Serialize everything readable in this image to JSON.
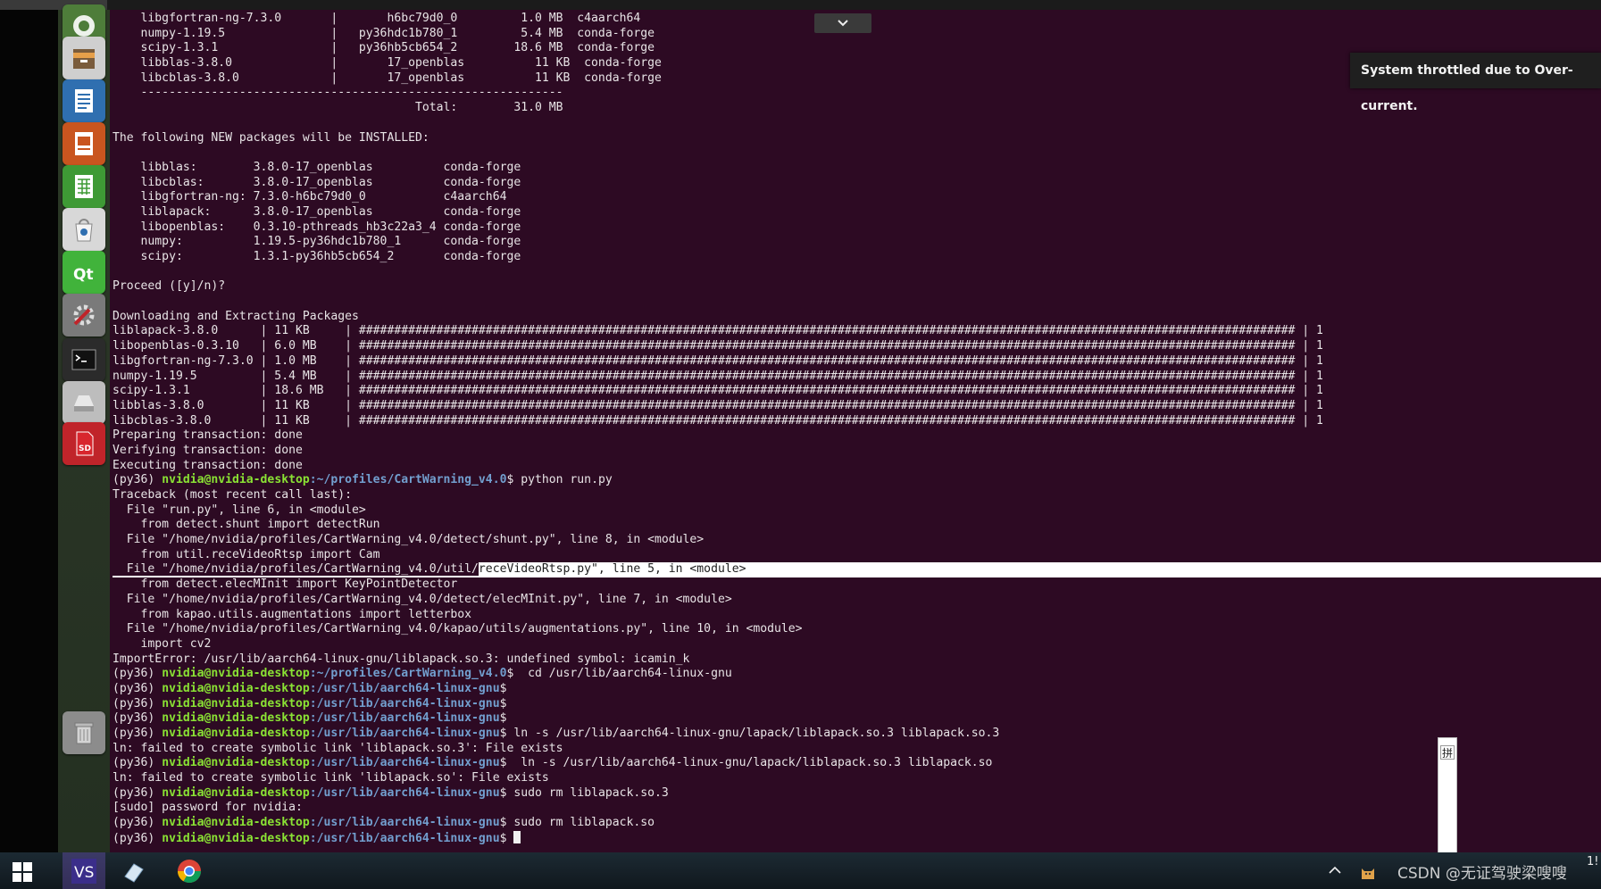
{
  "notification": "System throttled due to Over-current.",
  "ime_label": "拼",
  "watermark": "CSDN @无证驾驶梁嗖嗖",
  "clock_fragment": "1!",
  "launcher": [
    {
      "icon": "dash-home-icon",
      "bg": "#4e7d3a"
    },
    {
      "icon": "file-manager-icon",
      "bg": "#cfcfcf"
    },
    {
      "icon": "text-document-icon",
      "bg": "#2f6fb0"
    },
    {
      "icon": "presentation-icon",
      "bg": "#c9551f"
    },
    {
      "icon": "spreadsheet-icon",
      "bg": "#3e9a35"
    },
    {
      "icon": "software-center-icon",
      "bg": "#d8d8d8"
    },
    {
      "icon": "qt-creator-icon",
      "bg": "#41b33b"
    },
    {
      "icon": "system-settings-icon",
      "bg": "#7a7a7a"
    },
    {
      "icon": "terminal-icon",
      "bg": "#2b2b2b"
    },
    {
      "icon": "disk-drive-icon",
      "bg": "#bdbdbd"
    },
    {
      "icon": "sd-card-icon",
      "bg": "#c0242a"
    },
    {
      "icon": "trash-icon",
      "bg": "#8c8c8c"
    }
  ],
  "taskbar": [
    {
      "icon": "windows-start-icon"
    },
    {
      "icon": "visual-studio-code-icon"
    },
    {
      "icon": "eraser-app-icon"
    },
    {
      "icon": "chrome-icon"
    }
  ],
  "terminal": {
    "lines": [
      {
        "t": "    libgfortran-ng-7.3.0       |       h6bc79d0_0         1.0 MB  c4aarch64"
      },
      {
        "t": "    numpy-1.19.5               |   py36hdc1b780_1         5.4 MB  conda-forge"
      },
      {
        "t": "    scipy-1.3.1                |   py36hb5cb654_2        18.6 MB  conda-forge"
      },
      {
        "t": "    libblas-3.8.0              |       17_openblas          11 KB  conda-forge"
      },
      {
        "t": "    libcblas-3.8.0             |       17_openblas          11 KB  conda-forge"
      },
      {
        "t": "    ------------------------------------------------------------"
      },
      {
        "t": "                                           Total:        31.0 MB"
      },
      {
        "t": ""
      },
      {
        "t": "The following NEW packages will be INSTALLED:"
      },
      {
        "t": ""
      },
      {
        "t": "    libblas:        3.8.0-17_openblas          conda-forge"
      },
      {
        "t": "    libcblas:       3.8.0-17_openblas          conda-forge"
      },
      {
        "t": "    libgfortran-ng: 7.3.0-h6bc79d0_0           c4aarch64"
      },
      {
        "t": "    liblapack:      3.8.0-17_openblas          conda-forge"
      },
      {
        "t": "    libopenblas:    0.3.10-pthreads_hb3c22a3_4 conda-forge"
      },
      {
        "t": "    numpy:          1.19.5-py36hdc1b780_1      conda-forge"
      },
      {
        "t": "    scipy:          1.3.1-py36hb5cb654_2       conda-forge"
      },
      {
        "t": ""
      },
      {
        "t": "Proceed ([y]/n)?"
      },
      {
        "t": ""
      },
      {
        "t": "Downloading and Extracting Packages"
      },
      {
        "t": "liblapack-3.8.0      | 11 KB     | ##################################################################################################################################### | 1"
      },
      {
        "t": "libopenblas-0.3.10   | 6.0 MB    | ##################################################################################################################################### | 1"
      },
      {
        "t": "libgfortran-ng-7.3.0 | 1.0 MB    | ##################################################################################################################################### | 1"
      },
      {
        "t": "numpy-1.19.5         | 5.4 MB    | ##################################################################################################################################### | 1"
      },
      {
        "t": "scipy-1.3.1          | 18.6 MB   | ##################################################################################################################################### | 1"
      },
      {
        "t": "libblas-3.8.0        | 11 KB     | ##################################################################################################################################### | 1"
      },
      {
        "t": "libcblas-3.8.0       | 11 KB     | ##################################################################################################################################### | 1"
      },
      {
        "t": "Preparing transaction: done"
      },
      {
        "t": "Verifying transaction: done"
      },
      {
        "t": "Executing transaction: done"
      },
      {
        "env": "(py36) ",
        "user": "nvidia@nvidia-desktop",
        "path": ":~/profiles/CartWarning_v4.0",
        "cmd": "$ python run.py"
      },
      {
        "t": "Traceback (most recent call last):"
      },
      {
        "t": "  File \"run.py\", line 6, in <module>"
      },
      {
        "t": "    from detect.shunt import detectRun"
      },
      {
        "t": "  File \"/home/nvidia/profiles/CartWarning_v4.0/detect/shunt.py\", line 8, in <module>"
      },
      {
        "t": "    from util.receVideoRtsp import Cam"
      },
      {
        "pre": "  File \"/home/nvidia/profiles/CartWarning_v4.0/util/",
        "hl": "receVideoRtsp.py\", line 5, in <module>"
      },
      {
        "t": "    from detect.elecMInit import KeyPointDetector"
      },
      {
        "t": "  File \"/home/nvidia/profiles/CartWarning_v4.0/detect/elecMInit.py\", line 7, in <module>"
      },
      {
        "t": "    from kapao.utils.augmentations import letterbox"
      },
      {
        "t": "  File \"/home/nvidia/profiles/CartWarning_v4.0/kapao/utils/augmentations.py\", line 10, in <module>"
      },
      {
        "t": "    import cv2"
      },
      {
        "t": "ImportError: /usr/lib/aarch64-linux-gnu/liblapack.so.3: undefined symbol: icamin_k"
      },
      {
        "env": "(py36) ",
        "user": "nvidia@nvidia-desktop",
        "path": ":~/profiles/CartWarning_v4.0",
        "cmd": "$  cd /usr/lib/aarch64-linux-gnu"
      },
      {
        "env": "(py36) ",
        "user": "nvidia@nvidia-desktop",
        "path": ":/usr/lib/aarch64-linux-gnu",
        "cmd": "$"
      },
      {
        "env": "(py36) ",
        "user": "nvidia@nvidia-desktop",
        "path": ":/usr/lib/aarch64-linux-gnu",
        "cmd": "$"
      },
      {
        "env": "(py36) ",
        "user": "nvidia@nvidia-desktop",
        "path": ":/usr/lib/aarch64-linux-gnu",
        "cmd": "$"
      },
      {
        "env": "(py36) ",
        "user": "nvidia@nvidia-desktop",
        "path": ":/usr/lib/aarch64-linux-gnu",
        "cmd": "$ ln -s /usr/lib/aarch64-linux-gnu/lapack/liblapack.so.3 liblapack.so.3"
      },
      {
        "t": "ln: failed to create symbolic link 'liblapack.so.3': File exists"
      },
      {
        "env": "(py36) ",
        "user": "nvidia@nvidia-desktop",
        "path": ":/usr/lib/aarch64-linux-gnu",
        "cmd": "$  ln -s /usr/lib/aarch64-linux-gnu/lapack/liblapack.so.3 liblapack.so"
      },
      {
        "t": "ln: failed to create symbolic link 'liblapack.so': File exists"
      },
      {
        "env": "(py36) ",
        "user": "nvidia@nvidia-desktop",
        "path": ":/usr/lib/aarch64-linux-gnu",
        "cmd": "$ sudo rm liblapack.so.3"
      },
      {
        "t": "[sudo] password for nvidia:"
      },
      {
        "env": "(py36) ",
        "user": "nvidia@nvidia-desktop",
        "path": ":/usr/lib/aarch64-linux-gnu",
        "cmd": "$ sudo rm liblapack.so"
      },
      {
        "env": "(py36) ",
        "user": "nvidia@nvidia-desktop",
        "path": ":/usr/lib/aarch64-linux-gnu",
        "cmd": "$ ",
        "cursor": true
      }
    ]
  }
}
